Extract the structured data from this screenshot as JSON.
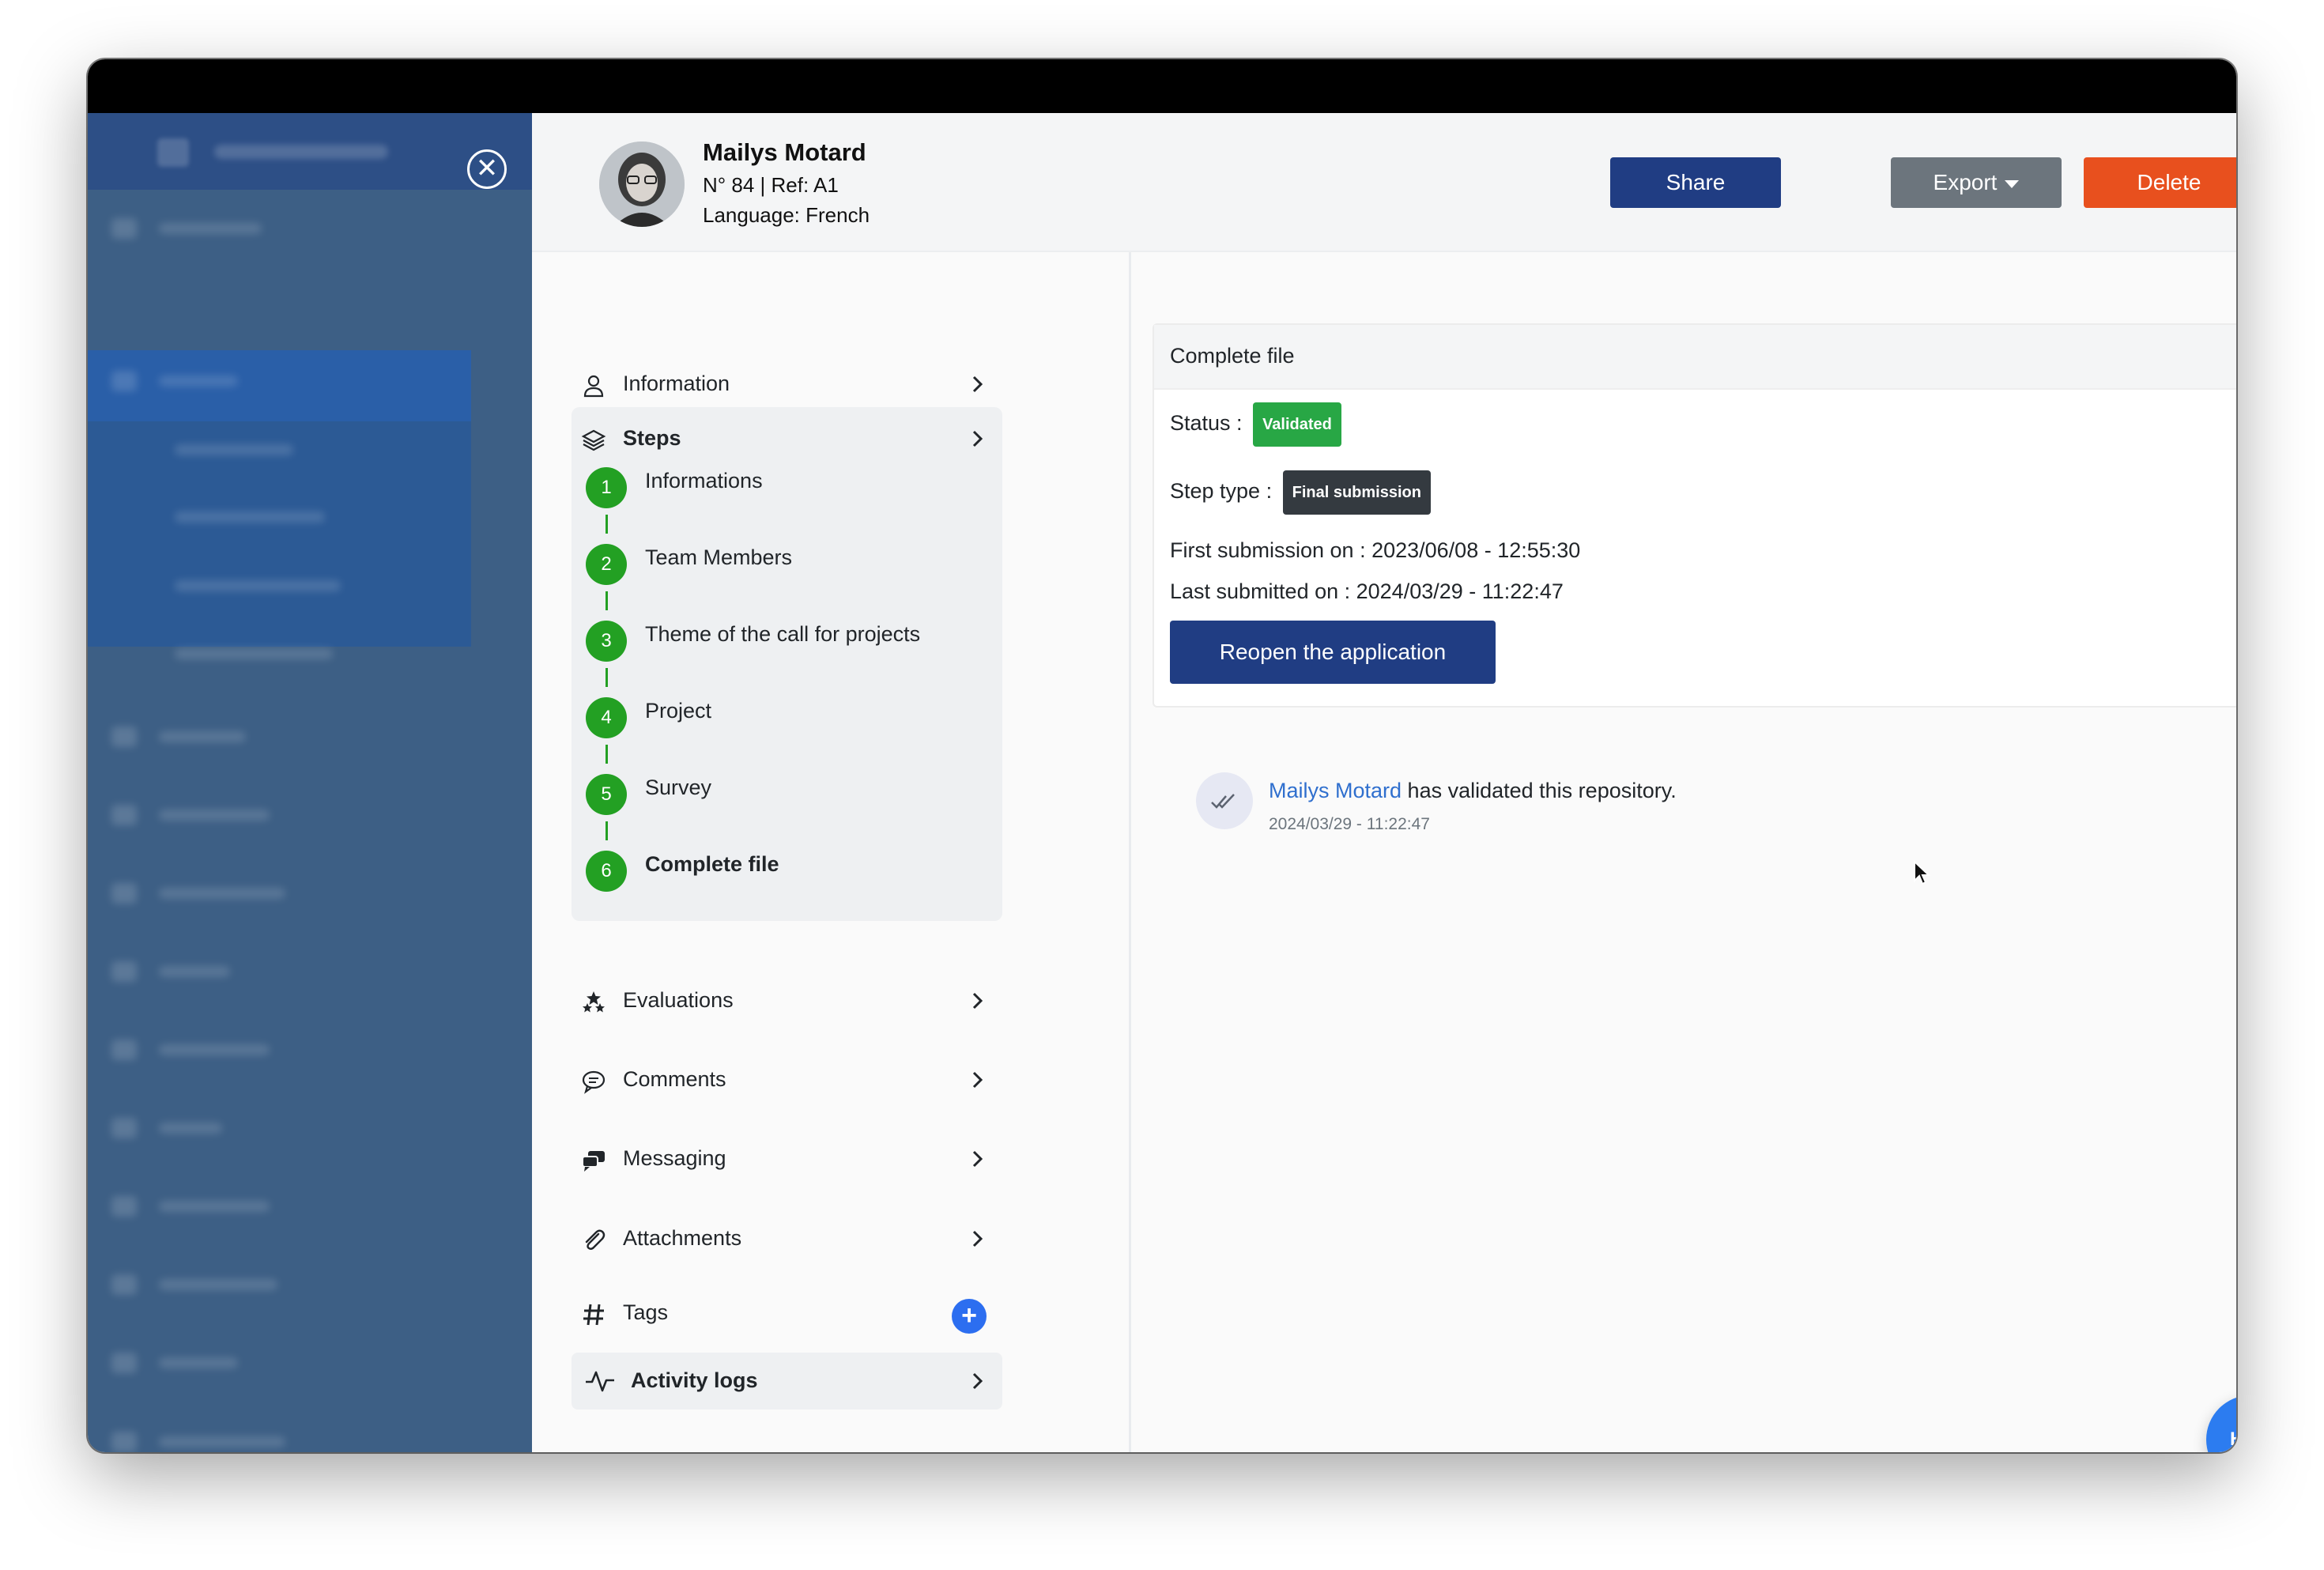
{
  "header": {
    "close_icon": "close-icon",
    "user": {
      "name": "Mailys Motard",
      "ref": "N° 84 | Ref: A1",
      "language": "Language: French"
    },
    "buttons": {
      "share": "Share",
      "export": "Export",
      "delete": "Delete"
    }
  },
  "nav": {
    "information": "Information",
    "steps": {
      "title": "Steps",
      "items": [
        {
          "num": "1",
          "label": "Informations"
        },
        {
          "num": "2",
          "label": "Team Members"
        },
        {
          "num": "3",
          "label": "Theme of the call for projects"
        },
        {
          "num": "4",
          "label": "Project"
        },
        {
          "num": "5",
          "label": "Survey"
        },
        {
          "num": "6",
          "label": "Complete file"
        }
      ]
    },
    "evaluations": "Evaluations",
    "comments": "Comments",
    "messaging": "Messaging",
    "attachments": "Attachments",
    "tags": "Tags",
    "tags_add": "+",
    "activity_logs": "Activity logs"
  },
  "content": {
    "title": "Complete file",
    "status_label": "Status :",
    "status_value": "Validated",
    "step_type_label": "Step type :",
    "step_type_value": "Final submission",
    "first_submission": "First submission on : 2023/06/08 - 12:55:30",
    "last_submitted": "Last submitted on : 2024/03/29 - 11:22:47",
    "reopen_button": "Reopen the application"
  },
  "log": {
    "user": "Mailys Motard",
    "text": " has validated this repository.",
    "date": "2024/03/29 - 11:22:47"
  },
  "help": "Help",
  "colors": {
    "primary": "#203d83",
    "danger": "#e8501e",
    "secondary": "#6c757d",
    "success": "#28a745",
    "step_green": "#23a023",
    "link": "#2f6fce",
    "help": "#2c7cf0"
  }
}
